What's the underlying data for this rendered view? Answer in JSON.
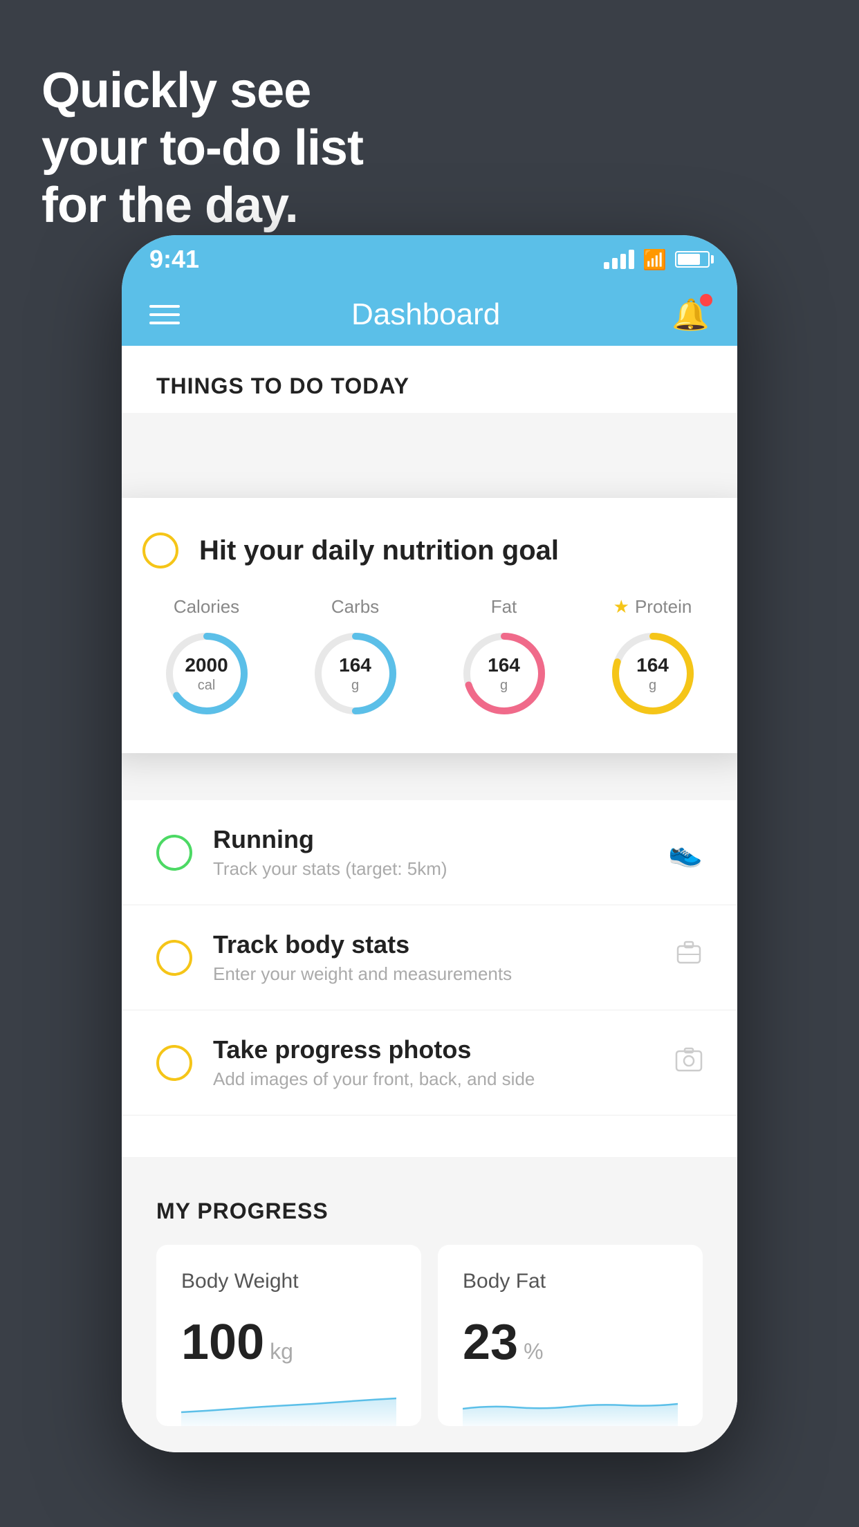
{
  "hero": {
    "line1": "Quickly see",
    "line2": "your to-do list",
    "line3": "for the day."
  },
  "status_bar": {
    "time": "9:41",
    "signal_label": "signal",
    "wifi_label": "wifi",
    "battery_label": "battery"
  },
  "nav": {
    "title": "Dashboard",
    "menu_label": "menu",
    "bell_label": "notifications"
  },
  "things_section": {
    "title": "THINGS TO DO TODAY"
  },
  "nutrition_card": {
    "title": "Hit your daily nutrition goal",
    "items": [
      {
        "label": "Calories",
        "value": "2000",
        "unit": "cal",
        "color": "#5bbfe8",
        "pct": 65
      },
      {
        "label": "Carbs",
        "value": "164",
        "unit": "g",
        "color": "#5bbfe8",
        "pct": 50
      },
      {
        "label": "Fat",
        "value": "164",
        "unit": "g",
        "color": "#f06a8a",
        "pct": 70
      },
      {
        "label": "Protein",
        "value": "164",
        "unit": "g",
        "color": "#f5c518",
        "pct": 80,
        "starred": true
      }
    ]
  },
  "todo_items": [
    {
      "id": "running",
      "title": "Running",
      "subtitle": "Track your stats (target: 5km)",
      "checkbox_color": "green",
      "icon": "👟"
    },
    {
      "id": "body-stats",
      "title": "Track body stats",
      "subtitle": "Enter your weight and measurements",
      "checkbox_color": "yellow",
      "icon": "⚖"
    },
    {
      "id": "progress-photos",
      "title": "Take progress photos",
      "subtitle": "Add images of your front, back, and side",
      "checkbox_color": "yellow",
      "icon": "🖼"
    }
  ],
  "progress_section": {
    "title": "MY PROGRESS",
    "cards": [
      {
        "id": "body-weight",
        "title": "Body Weight",
        "value": "100",
        "unit": "kg"
      },
      {
        "id": "body-fat",
        "title": "Body Fat",
        "value": "23",
        "unit": "%"
      }
    ]
  }
}
